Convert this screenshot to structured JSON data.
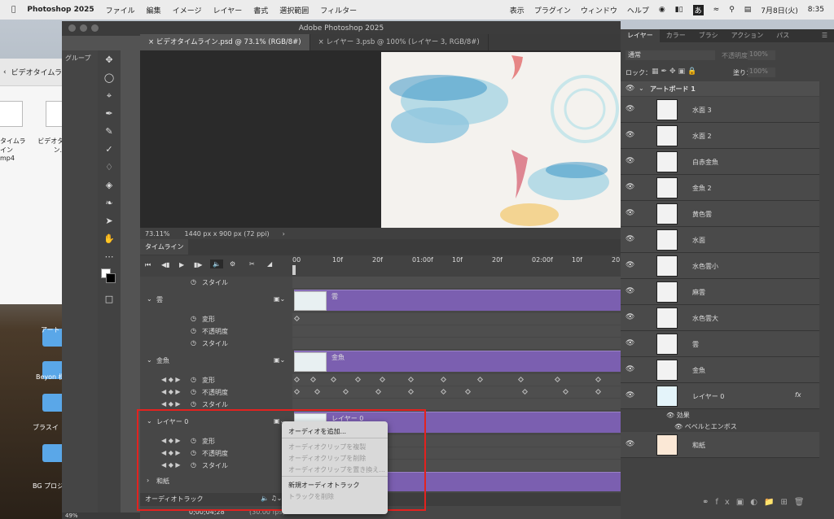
{
  "menubar": {
    "app": "Photoshop 2025",
    "items": [
      "ファイル",
      "編集",
      "イメージ",
      "レイヤー",
      "書式",
      "選択範囲",
      "フィルター"
    ],
    "right": [
      "表示",
      "プラグイン",
      "ウィンドウ",
      "ヘルプ"
    ],
    "ime": "あ",
    "date": "7月8日(火)",
    "time": "8:35"
  },
  "finder": {
    "title": "ビデオタイムライン",
    "group_label": "グループ",
    "files": [
      {
        "name": "タイムライン\nmp4"
      },
      {
        "name": "ビデオタイムライン.psd"
      }
    ]
  },
  "desktop": {
    "labels": [
      "アート",
      "Beyon 様",
      "ブラスイ",
      "BG プロジ"
    ]
  },
  "ps": {
    "title": "Adobe Photoshop 2025",
    "tabs": [
      {
        "label": "ビデオタイムライン.psd @ 73.1% (RGB/8#)",
        "active": true
      },
      {
        "label": "レイヤー 3.psb @ 100% (レイヤー 3, RGB/8#)",
        "active": false
      }
    ],
    "zoom": "73.11%",
    "docsize": "1440 px x 900 px (72 ppi)",
    "bottom_zoom": "49%",
    "timeline_tab": "タイムライン",
    "ruler_labels": [
      "00",
      "10f",
      "20f",
      "01:00f",
      "10f",
      "20f",
      "02:00f",
      "10f",
      "20"
    ],
    "timecode": "0;00;04;28",
    "fps": "(30.00 fps)",
    "tracks": [
      {
        "type": "prop",
        "label": "スタイル"
      },
      {
        "type": "layer",
        "label": "雲",
        "clip_label": "雲"
      },
      {
        "type": "prop",
        "label": "変形"
      },
      {
        "type": "prop",
        "label": "不透明度"
      },
      {
        "type": "prop",
        "label": "スタイル"
      },
      {
        "type": "layer",
        "label": "金魚",
        "clip_label": "金魚"
      },
      {
        "type": "prop",
        "label": "変形"
      },
      {
        "type": "prop",
        "label": "不透明度"
      },
      {
        "type": "prop",
        "label": "スタイル"
      },
      {
        "type": "layer",
        "label": "レイヤー 0",
        "clip_label": "レイヤー 0"
      },
      {
        "type": "prop",
        "label": "変形"
      },
      {
        "type": "prop",
        "label": "不透明度"
      },
      {
        "type": "prop",
        "label": "スタイル"
      },
      {
        "type": "group",
        "label": "和紙"
      },
      {
        "type": "audio",
        "label": "オーディオトラック"
      }
    ]
  },
  "context_menu": {
    "items": [
      {
        "label": "オーディオを追加...",
        "disabled": false
      },
      {
        "sep": true
      },
      {
        "label": "オーディオクリップを複製",
        "disabled": true
      },
      {
        "label": "オーディオクリップを削除",
        "disabled": true
      },
      {
        "label": "オーディオクリップを置き換え...",
        "disabled": true
      },
      {
        "sep": true
      },
      {
        "label": "新規オーディオトラック",
        "disabled": false
      },
      {
        "label": "トラックを削除",
        "disabled": true
      }
    ]
  },
  "layers_panel": {
    "tabs": [
      "レイヤー",
      "カラー",
      "ブラシ",
      "アクション",
      "パス"
    ],
    "blend_mode": "通常",
    "opacity_label": "不透明度：",
    "opacity": "100%",
    "lock_label": "ロック：",
    "fill_label": "塗り：",
    "fill": "100%",
    "artboard": "アートボード 1",
    "layers": [
      "水面 3",
      "水面 2",
      "白赤金魚",
      "金魚 2",
      "黄色雲",
      "水面",
      "水色雲小",
      "麻雲",
      "水色雲大",
      "雲",
      "金魚",
      "レイヤー 0",
      "和紙"
    ],
    "effects_label": "効果",
    "effect_item": "ベベルとエンボス",
    "fx": "fx"
  },
  "colors": {
    "clip": "#7b5fb0",
    "highlight": "#e3221f",
    "keyframe": "#e7c02c"
  }
}
